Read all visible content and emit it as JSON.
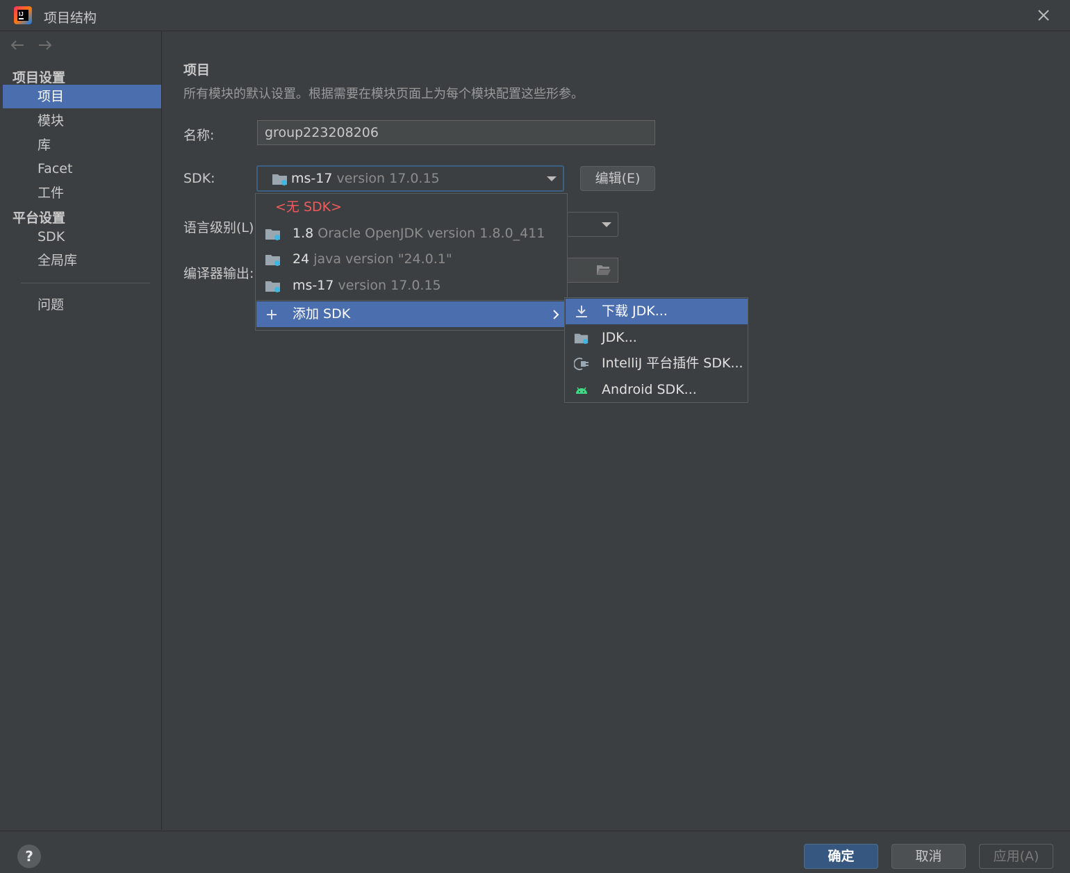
{
  "window": {
    "title": "项目结构",
    "close_icon": "close-icon",
    "logo": "intellij-logo"
  },
  "sidebar": {
    "back_icon": "arrow-left-icon",
    "forward_icon": "arrow-right-icon",
    "sections": [
      {
        "label": "项目设置",
        "items": [
          "项目",
          "模块",
          "库",
          "Facet",
          "工件"
        ]
      },
      {
        "label": "平台设置",
        "items": [
          "SDK",
          "全局库"
        ]
      }
    ],
    "problems": "问题",
    "selected": "项目"
  },
  "main": {
    "title": "项目",
    "description": "所有模块的默认设置。根据需要在模块页面上为每个模块配置这些形参。",
    "name_label": "名称:",
    "name_value": "group223208206",
    "sdk_label": "SDK:",
    "sdk_selected": {
      "name": "ms-17",
      "version": " version 17.0.15"
    },
    "edit_button": "编辑(E)",
    "language_level_label": "语言级别(L):",
    "compiler_output_label": "编译器输出:"
  },
  "sdk_popup": {
    "no_sdk": "<无 SDK>",
    "items": [
      {
        "name": "1.8",
        "version": " Oracle OpenJDK version 1.8.0_411"
      },
      {
        "name": "24",
        "version": " java version \"24.0.1\""
      },
      {
        "name": "ms-17",
        "version": " version 17.0.15"
      }
    ],
    "add_sdk": "添加 SDK"
  },
  "add_sdk_submenu": {
    "items": [
      {
        "label": "下载 JDK...",
        "icon": "download-icon"
      },
      {
        "label": "JDK...",
        "icon": "folder-icon"
      },
      {
        "label": "IntelliJ 平台插件 SDK...",
        "icon": "plugin-icon"
      },
      {
        "label": "Android SDK...",
        "icon": "android-icon"
      }
    ]
  },
  "footer": {
    "help": "?",
    "ok": "确定",
    "cancel": "取消",
    "apply": "应用(A)"
  },
  "colors": {
    "selection": "#4b6eaf",
    "background": "#3c3f41",
    "error_text": "#f25b5b",
    "primary_button": "#365880"
  }
}
